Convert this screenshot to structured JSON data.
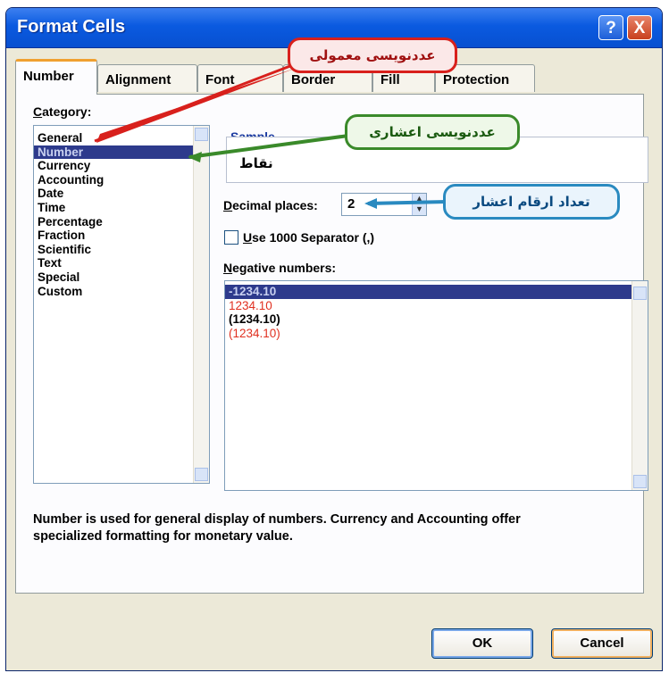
{
  "window": {
    "title": "Format Cells"
  },
  "titlebar": {
    "help": "?",
    "close": "X"
  },
  "tabs": [
    {
      "label": "Number"
    },
    {
      "label": "Alignment"
    },
    {
      "label": "Font"
    },
    {
      "label": "Border"
    },
    {
      "label": "Fill"
    },
    {
      "label": "Protection"
    }
  ],
  "category": {
    "label_hotkey": "C",
    "label_rest": "ategory:",
    "items": [
      "General",
      "Number",
      "Currency",
      "Accounting",
      "Date",
      "Time",
      "Percentage",
      "Fraction",
      "Scientific",
      "Text",
      "Special",
      "Custom"
    ],
    "selected": "Number"
  },
  "sample": {
    "label": "Sample",
    "value": "نقاط"
  },
  "decimal": {
    "label_hotkey": "D",
    "label_rest": "ecimal places:",
    "value": "2"
  },
  "separator": {
    "label_hotkey": "U",
    "label_rest": "se 1000 Separator (,)",
    "checked": false
  },
  "negative": {
    "label_hotkey": "N",
    "label_rest": "egative numbers:",
    "items": [
      {
        "text": "-1234.10",
        "color": "#000000"
      },
      {
        "text": "1234.10",
        "color": "#e03020"
      },
      {
        "text": "(1234.10)",
        "color": "#000000"
      },
      {
        "text": "(1234.10)",
        "color": "#e03020"
      }
    ]
  },
  "description": {
    "line1": "Number is used for general display of numbers.  Currency and Accounting offer",
    "line2": "specialized formatting for monetary value."
  },
  "buttons": {
    "ok": "OK",
    "cancel": "Cancel"
  },
  "annotations": {
    "general": "عددنویسی معمولی",
    "decimal": "عددنویسی اعشاری",
    "places": "تعداد ارقام اعشار"
  },
  "colors": {
    "red": "#d8201c",
    "green": "#3a8a2a",
    "blue": "#2a8ac0",
    "selection": "#2d3a8c"
  }
}
